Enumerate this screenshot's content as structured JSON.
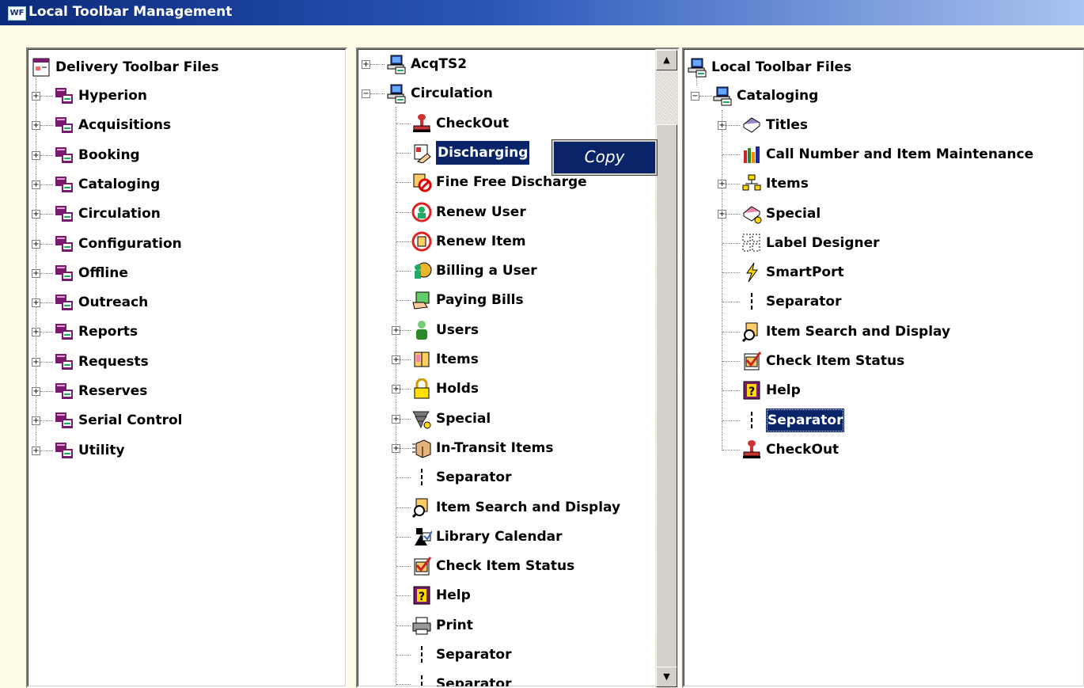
{
  "window": {
    "app_badge": "WF",
    "title": "Local Toolbar Management"
  },
  "delivery": {
    "root": "Delivery Toolbar Files",
    "items": [
      "Hyperion",
      "Acquisitions",
      "Booking",
      "Cataloging",
      "Circulation",
      "Configuration",
      "Offline",
      "Outreach",
      "Reports",
      "Requests",
      "Reserves",
      "Serial Control",
      "Utility"
    ]
  },
  "middle": {
    "top_item": "AcqTS2",
    "group": "Circulation",
    "items": [
      {
        "label": "CheckOut",
        "icon": "checkout-stamp-icon"
      },
      {
        "label": "Discharging",
        "icon": "discharging-icon",
        "selected": true
      },
      {
        "label": "Fine Free Discharge",
        "icon": "fine-free-discharge-icon"
      },
      {
        "label": "Renew User",
        "icon": "renew-user-icon"
      },
      {
        "label": "Renew Item",
        "icon": "renew-item-icon"
      },
      {
        "label": "Billing a User",
        "icon": "billing-user-icon"
      },
      {
        "label": "Paying Bills",
        "icon": "paying-bills-icon"
      },
      {
        "label": "Users",
        "icon": "users-icon",
        "expandable": true
      },
      {
        "label": "Items",
        "icon": "items-book-icon",
        "expandable": true
      },
      {
        "label": "Holds",
        "icon": "holds-lock-icon",
        "expandable": true
      },
      {
        "label": "Special",
        "icon": "special-tornado-icon",
        "expandable": true
      },
      {
        "label": "In-Transit Items",
        "icon": "in-transit-box-icon",
        "expandable": true
      },
      {
        "label": "Separator",
        "icon": "separator-icon"
      },
      {
        "label": "Item Search and Display",
        "icon": "item-search-icon"
      },
      {
        "label": "Library Calendar",
        "icon": "library-calendar-icon"
      },
      {
        "label": "Check Item Status",
        "icon": "check-item-status-icon"
      },
      {
        "label": "Help",
        "icon": "help-icon"
      },
      {
        "label": "Print",
        "icon": "print-icon"
      },
      {
        "label": "Separator",
        "icon": "separator-icon"
      },
      {
        "label": "Separator",
        "icon": "separator-icon"
      }
    ]
  },
  "context_menu": {
    "copy_label": "Copy"
  },
  "local": {
    "root": "Local Toolbar Files",
    "group": "Cataloging",
    "items": [
      {
        "label": "Titles",
        "icon": "titles-book-icon",
        "expandable": true
      },
      {
        "label": "Call Number and Item Maintenance",
        "icon": "call-number-icon"
      },
      {
        "label": "Items",
        "icon": "items-hierarchy-icon",
        "expandable": true
      },
      {
        "label": "Special",
        "icon": "special-book-icon",
        "expandable": true
      },
      {
        "label": "Label Designer",
        "icon": "label-designer-icon"
      },
      {
        "label": "SmartPort",
        "icon": "smartport-lightning-icon"
      },
      {
        "label": "Separator",
        "icon": "separator-icon"
      },
      {
        "label": "Item Search and Display",
        "icon": "item-search-icon"
      },
      {
        "label": "Check Item Status",
        "icon": "check-item-status-icon"
      },
      {
        "label": "Help",
        "icon": "help-icon"
      },
      {
        "label": "Separator",
        "icon": "separator-icon",
        "selected": true
      },
      {
        "label": "CheckOut",
        "icon": "checkout-stamp-icon"
      }
    ]
  },
  "colors": {
    "selection": "#0a246a",
    "folder_purple": "#7a1a6e",
    "background": "#fdfbe4"
  }
}
